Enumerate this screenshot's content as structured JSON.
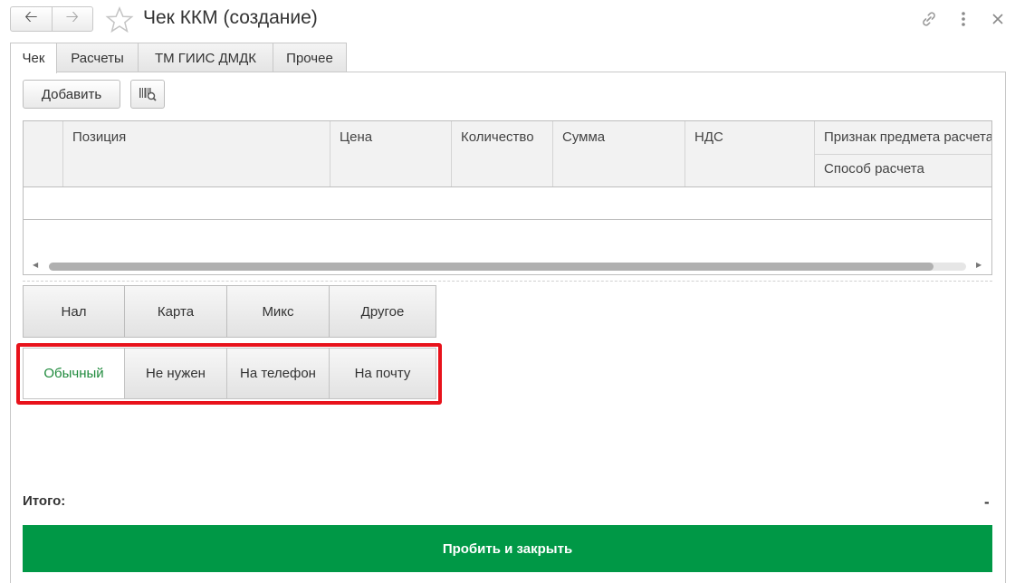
{
  "window": {
    "title": "Чек ККМ (создание)",
    "back_icon": "arrow-left-icon",
    "forward_icon": "arrow-right-icon",
    "favorite_icon": "star-icon",
    "link_icon": "link-icon",
    "more_icon": "more-vertical-icon",
    "close_icon": "close-icon"
  },
  "tabs": [
    {
      "label": "Чек",
      "active": true
    },
    {
      "label": "Расчеты",
      "active": false
    },
    {
      "label": "ТМ ГИИС ДМДК",
      "active": false
    },
    {
      "label": "Прочее",
      "active": false
    }
  ],
  "toolbar": {
    "add_label": "Добавить",
    "barcode_icon": "barcode-search-icon"
  },
  "table": {
    "columns": [
      "Позиция",
      "Цена",
      "Количество",
      "Сумма",
      "НДС",
      "Признак предмета расчета"
    ],
    "sub_column": "Способ расчета",
    "rows": []
  },
  "payment_buttons": [
    "Нал",
    "Карта",
    "Микс",
    "Другое"
  ],
  "receipt_buttons": [
    {
      "label": "Обычный",
      "selected": true
    },
    {
      "label": "Не нужен",
      "selected": false
    },
    {
      "label": "На телефон",
      "selected": false
    },
    {
      "label": "На почту",
      "selected": false
    }
  ],
  "totals": {
    "label": "Итого:",
    "value": "-"
  },
  "primary_action": "Пробить и закрыть",
  "colors": {
    "primary": "#009846",
    "highlight": "#e8121b",
    "selected_text": "#1f8a3c"
  }
}
